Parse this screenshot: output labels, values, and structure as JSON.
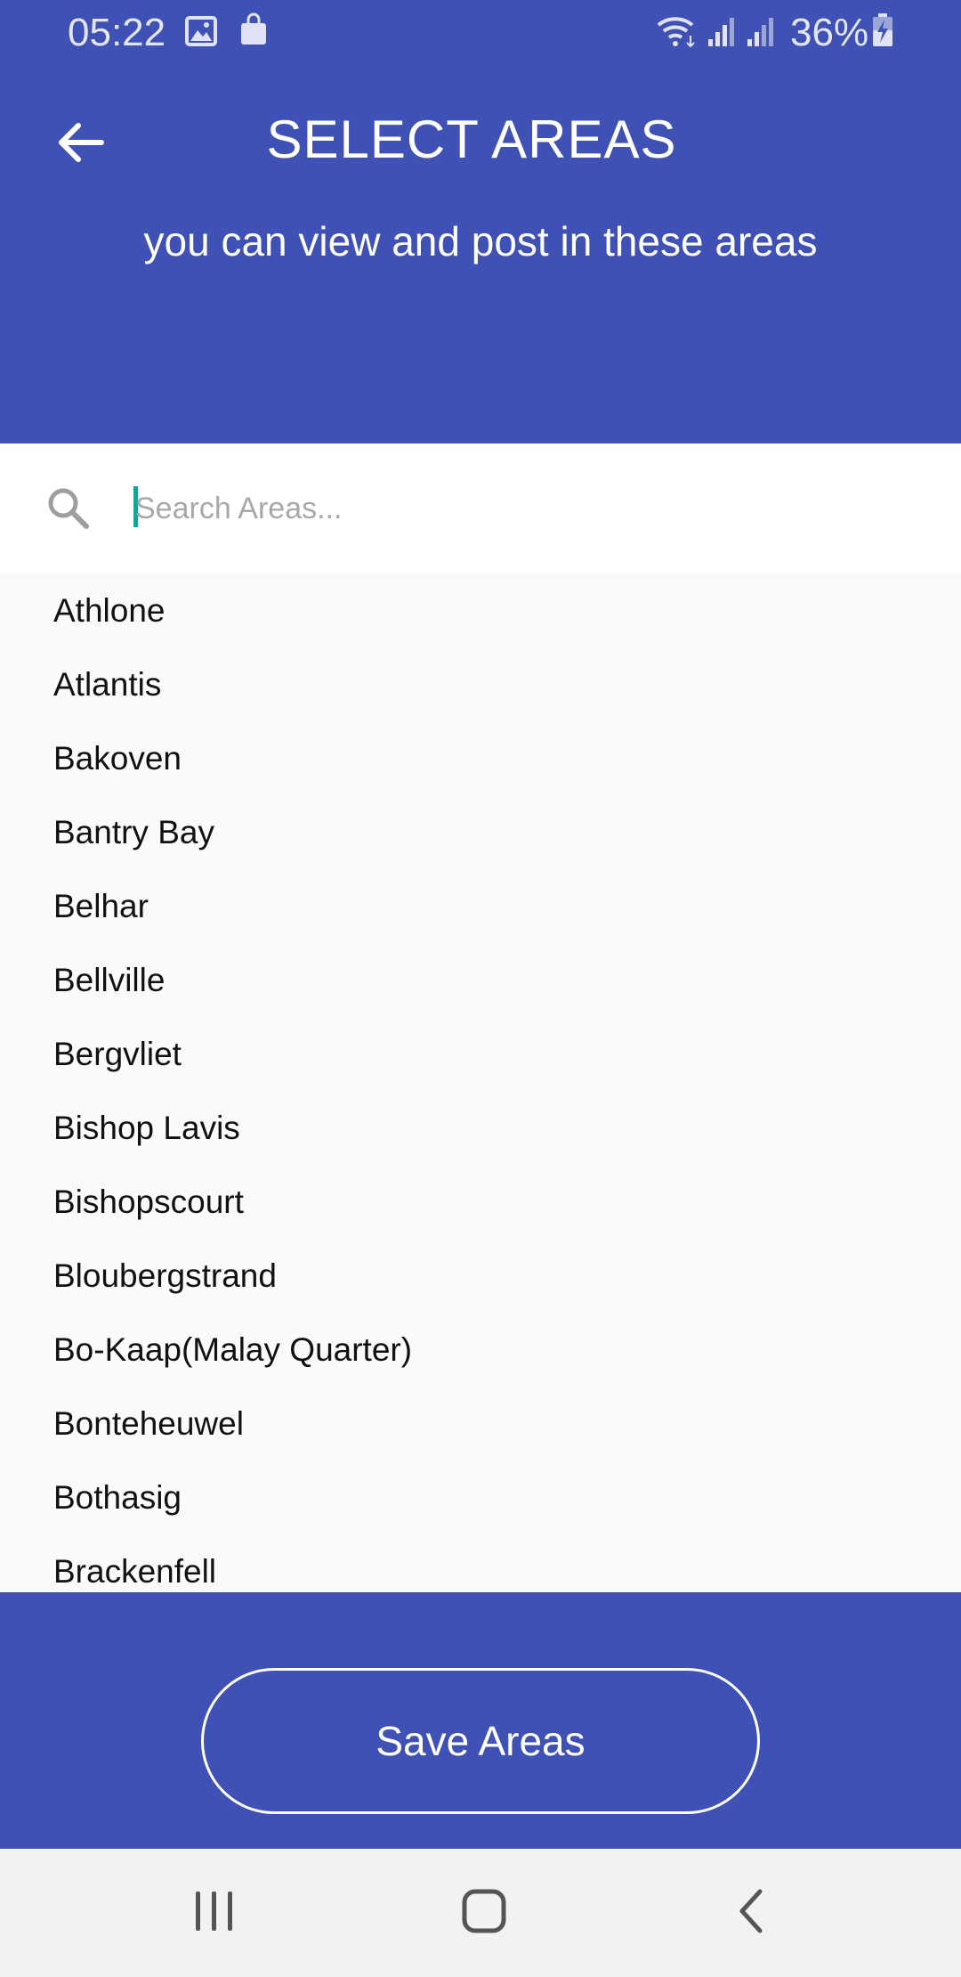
{
  "status_bar": {
    "time": "05:22",
    "battery": "36%",
    "icons": [
      "image-icon",
      "bag-icon",
      "wifi-icon",
      "signal-icon",
      "signal-icon",
      "battery-charging-icon"
    ]
  },
  "header": {
    "back_icon": "arrow-left-icon",
    "title": "SELECT AREAS",
    "subtitle": "you can view and post in these areas"
  },
  "search": {
    "icon": "search-icon",
    "placeholder": "Search Areas...",
    "value": ""
  },
  "areas": [
    "Athlone",
    "Atlantis",
    "Bakoven",
    "Bantry Bay",
    "Belhar",
    "Bellville",
    "Bergvliet",
    "Bishop Lavis",
    "Bishopscourt",
    "Bloubergstrand",
    "Bo-Kaap(Malay Quarter)",
    "Bonteheuwel",
    "Bothasig",
    "Brackenfell"
  ],
  "footer": {
    "save_label": "Save Areas"
  },
  "nav_bar": {
    "icons": [
      "recent-apps-icon",
      "home-icon",
      "back-icon"
    ]
  },
  "colors": {
    "primary": "#3f51b5",
    "list_background": "#fafafa",
    "caret": "#1aa394"
  }
}
